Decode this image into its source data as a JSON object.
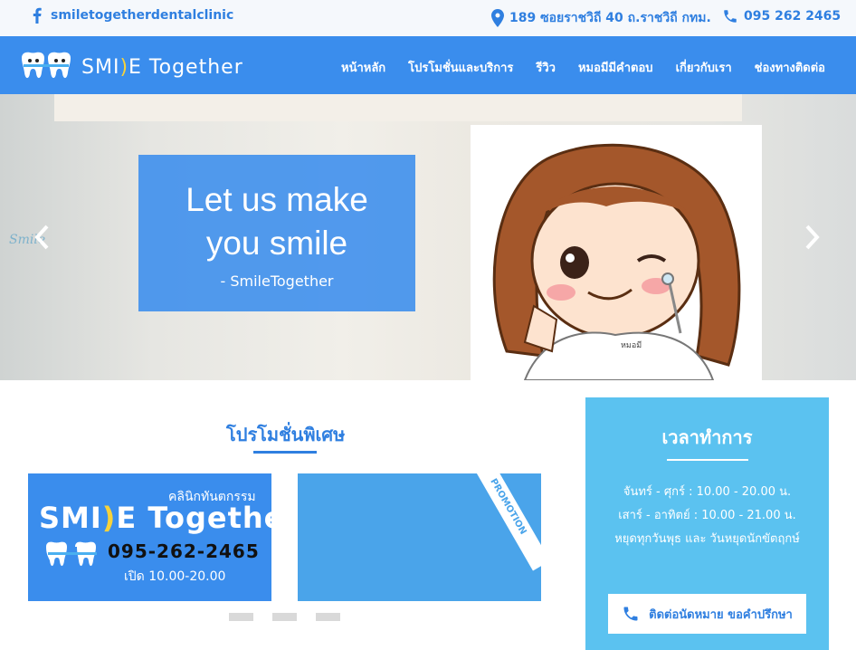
{
  "topbar": {
    "facebook": "smiletogetherdentalclinic",
    "address": "189 ซอยราชวิถี 40 ถ.ราชวิถี กทม.",
    "phone": "095 262 2465"
  },
  "brand": {
    "part1": "SMI",
    "part2": "E Together",
    "accent": "#f6d23b"
  },
  "nav": [
    "หน้าหลัก",
    "โปรโมชั่นและบริการ",
    "รีวิว",
    "หมอมีมีคำตอบ",
    "เกี่ยวกับเรา",
    "ช่องทางติดต่อ"
  ],
  "hero": {
    "headline_1": "Let us make",
    "headline_2": "you smile",
    "byline": "- SmileTogether",
    "cartoon_tag": "หมอมี",
    "wall_sign": "Smile"
  },
  "promo": {
    "title": "โปรโมชั่นพิเศษ",
    "card1": {
      "clinic": "คลินิกทันตกรรม",
      "brand": "SMI",
      "brand2": "E Together",
      "phone": "095-262-2465",
      "hours": "เปิด 10.00-20.00"
    },
    "card2": {
      "ribbon": "PROMOTION"
    }
  },
  "hours": {
    "title": "เวลาทำการ",
    "weekday": "จันทร์ - ศุกร์ : 10.00 - 20.00 น.",
    "weekend": "เสาร์ - อาทิตย์ : 10.00 - 21.00 น.",
    "closed": "หยุดทุกวันพุธ และ วันหยุดนักขัตฤกษ์",
    "button": "ติดต่อนัดหมาย ขอคำปรึกษา"
  },
  "colors": {
    "primary": "#3a8ded",
    "light": "#5bc2f0"
  }
}
